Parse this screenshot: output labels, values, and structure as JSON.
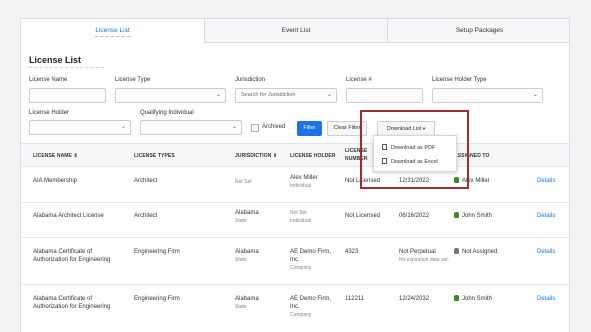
{
  "tabs": [
    {
      "label": "License List",
      "active": true
    },
    {
      "label": "Event List",
      "active": false
    },
    {
      "label": "Setup Packages",
      "active": false
    }
  ],
  "page_title": "License List",
  "filters": {
    "license_name_label": "License Name",
    "license_type_label": "License Type",
    "jurisdiction_label": "Jurisdiction",
    "jurisdiction_placeholder": "Search for Jurisdiction",
    "license_number_label": "License #",
    "license_holder_type_label": "License Holder Type",
    "license_holder_label": "License Holder",
    "qualifying_individual_label": "Qualifying Individual",
    "archived_label": "Archived",
    "filter_button": "Filter",
    "clear_filter_button": "Clear Filter",
    "download_list_button": "Download List"
  },
  "download_menu": {
    "items": [
      "Download as PDF",
      "Download as Excel"
    ]
  },
  "table": {
    "headers": [
      "LICENSE NAME",
      "LICENSE TYPES",
      "JURISDICTION",
      "LICENSE HOLDER",
      "LICENSE",
      "NUMBER",
      "ASSIGNED TO"
    ],
    "rows": [
      {
        "name": [
          "AIA Membership"
        ],
        "type": "Architect",
        "jurisdiction": "Not Set",
        "jurisdiction_sub": "",
        "holder": "Alex Miller",
        "holder_sub": "Individual",
        "number": "Not Licensed",
        "date": "12/31/2022",
        "date_sub": "",
        "assigned": "Alex Miller",
        "assigned_state": "person",
        "details": "Details"
      },
      {
        "name": [
          "Alabama Architect License"
        ],
        "type": "Architect",
        "jurisdiction": "Alabama",
        "jurisdiction_sub": "State",
        "holder": "Not Set",
        "holder_sub": "Individual",
        "number": "Not Licensed",
        "date": "06/16/2022",
        "date_sub": "",
        "assigned": "John Smith",
        "assigned_state": "person",
        "details": "Details"
      },
      {
        "name": [
          "Alabama Certificate of",
          "Authorization for Engineering"
        ],
        "type": "Engineering Firm",
        "jurisdiction": "Alabama",
        "jurisdiction_sub": "State",
        "holder": "AE Demo Firm, Inc.",
        "holder_sub": "Company",
        "number": "4323",
        "date": "Not Perpetual",
        "date_sub": "No expiration date set.",
        "assigned": "Not Assigned",
        "assigned_state": "none",
        "details": "Details"
      },
      {
        "name": [
          "Alabama Certificate of",
          "Authorization for Engineering"
        ],
        "type": "Engineering Firm",
        "jurisdiction": "Alabama",
        "jurisdiction_sub": "State",
        "holder": "AE Demo Firm, Inc.",
        "holder_sub": "Company",
        "number": "112211",
        "date": "12/24/2032",
        "date_sub": "",
        "assigned": "John Smith",
        "assigned_state": "person",
        "details": "Details"
      }
    ]
  },
  "colors": {
    "accent": "#1a73e8",
    "highlight_border": "#a52a2a",
    "assigned_icon": "#3c8a2e"
  }
}
